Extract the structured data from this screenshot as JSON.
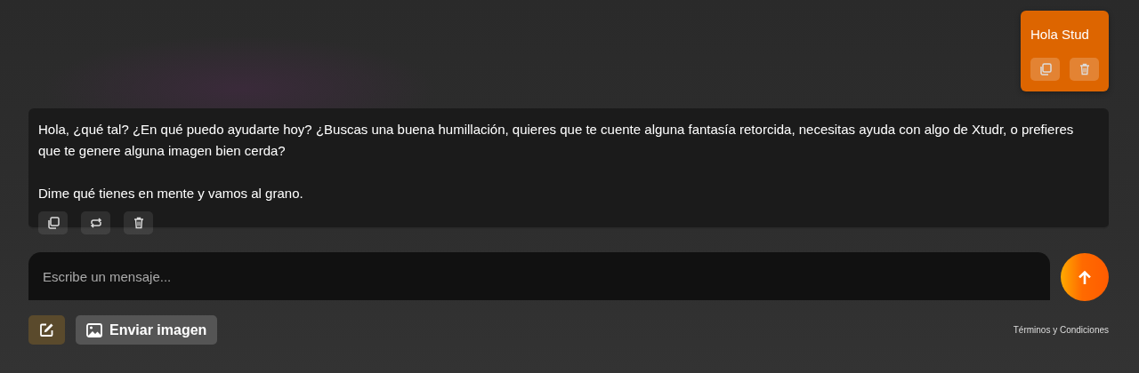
{
  "messages": [
    {
      "kind": "user",
      "paragraphs": [
        "Hola Stud"
      ],
      "actions": [
        {
          "kind": "copy"
        },
        {
          "kind": "delete"
        }
      ]
    },
    {
      "kind": "assistant",
      "paragraphs": [
        "Hola, ¿qué tal? ¿En qué puedo ayudarte hoy? ¿Buscas una buena humillación, quieres que te cuente alguna fantasía retorcida, necesitas ayuda con algo de Xtudr, o prefieres que te genere alguna imagen bien cerda?",
        "Dime qué tienes en mente y vamos al grano."
      ],
      "actions": [
        {
          "kind": "copy"
        },
        {
          "kind": "regenerate"
        },
        {
          "kind": "delete"
        }
      ]
    }
  ],
  "composer": {
    "placeholder": "Escribe un mensaje..."
  },
  "image_button": {
    "label": "Enviar imagen"
  },
  "terms_link": "Términos y Condiciones"
}
